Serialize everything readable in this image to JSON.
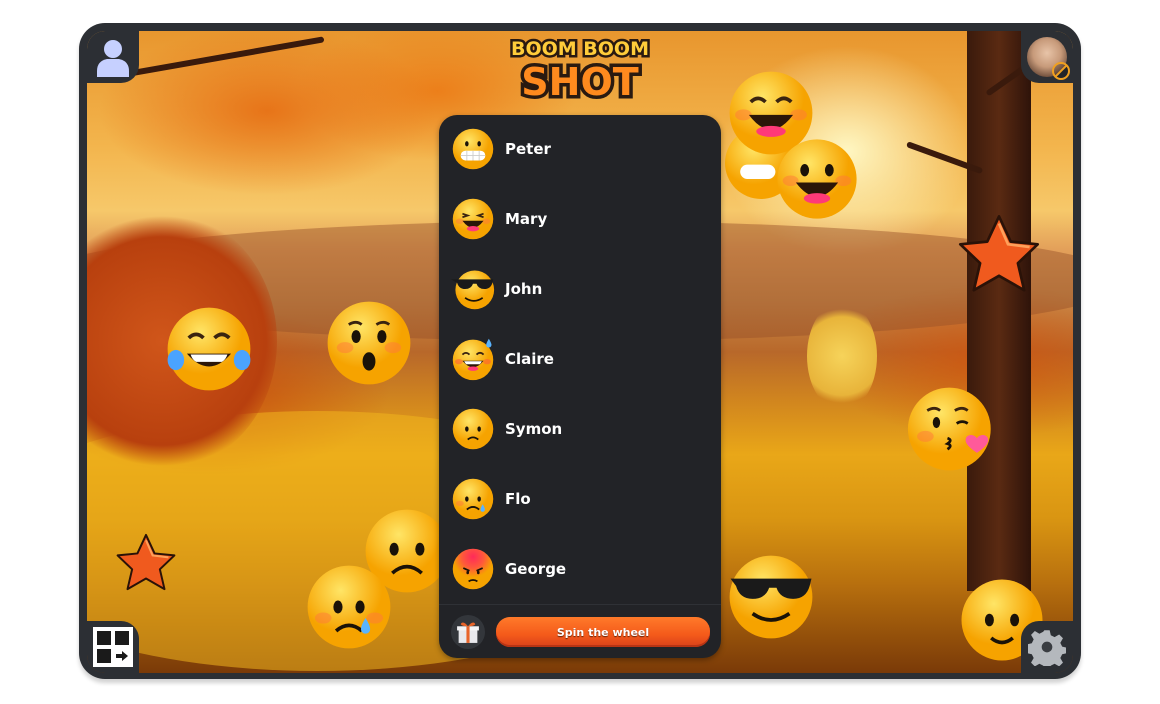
{
  "game": {
    "title_line1": "BOOM BOOM",
    "title_line2": "SHOT"
  },
  "players": [
    {
      "name": "Peter",
      "emoji": "grimacing-face"
    },
    {
      "name": "Mary",
      "emoji": "grinning-squinting-face"
    },
    {
      "name": "John",
      "emoji": "sunglasses-face"
    },
    {
      "name": "Claire",
      "emoji": "grinning-sweat-face"
    },
    {
      "name": "Symon",
      "emoji": "frowning-face"
    },
    {
      "name": "Flo",
      "emoji": "sad-tear-face"
    },
    {
      "name": "George",
      "emoji": "angry-face"
    }
  ],
  "actions": {
    "spin_label": "Spin the wheel",
    "gift_icon": "gift-icon"
  },
  "corners": {
    "top_left": "user-profile-icon",
    "top_right": "player-avatar-blocked",
    "bottom_left": "layout-switch-icon",
    "bottom_right": "settings-gear-icon"
  },
  "colors": {
    "panel_bg": "#222327",
    "frame": "#2c2f34",
    "spin_button": "#f45a1a",
    "logo_yellow": "#ffcc3a",
    "logo_orange": "#ff8a1e"
  }
}
